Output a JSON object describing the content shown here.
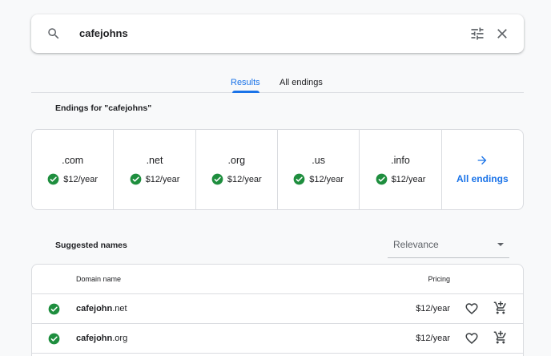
{
  "search": {
    "query": "cafejohns"
  },
  "tabs": [
    {
      "label": "Results",
      "active": true
    },
    {
      "label": "All endings",
      "active": false
    }
  ],
  "endings": {
    "heading": "Endings for \"cafejohns\"",
    "items": [
      {
        "tld": ".com",
        "price": "$12/year",
        "available": true
      },
      {
        "tld": ".net",
        "price": "$12/year",
        "available": true
      },
      {
        "tld": ".org",
        "price": "$12/year",
        "available": true
      },
      {
        "tld": ".us",
        "price": "$12/year",
        "available": true
      },
      {
        "tld": ".info",
        "price": "$12/year",
        "available": true
      }
    ],
    "all_label": "All endings"
  },
  "suggested": {
    "heading": "Suggested names",
    "sort_value": "Relevance",
    "columns": {
      "name": "Domain name",
      "pricing": "Pricing"
    },
    "rows": [
      {
        "name": "cafejohn",
        "tld": ".net",
        "price": "$12/year",
        "available": true
      },
      {
        "name": "cafejohn",
        "tld": ".org",
        "price": "$12/year",
        "available": true
      }
    ]
  },
  "colors": {
    "accent": "#1a73e8",
    "available": "#1e8e3e",
    "border": "#dadce0"
  }
}
